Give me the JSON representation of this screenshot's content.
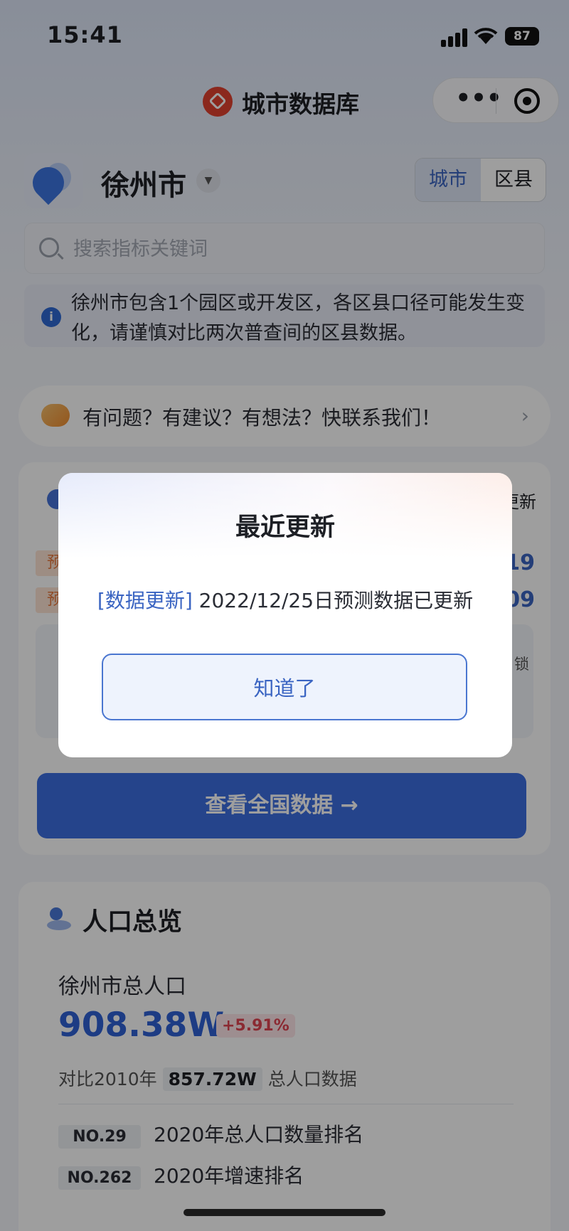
{
  "status_bar": {
    "time": "15:41",
    "battery": "87"
  },
  "nav": {
    "title": "城市数据库",
    "menu_glyph": "•••"
  },
  "city": {
    "name": "徐州市",
    "toggle": {
      "city": "城市",
      "district": "区县"
    }
  },
  "search": {
    "placeholder": "搜索指标关键词"
  },
  "notice": {
    "text": "徐州市包含1个园区或开发区，各区县口径可能发生变化，请谨慎对比两次普查间的区县数据。"
  },
  "feedback": {
    "text": "有问题？有建议？有想法？快联系我们！",
    "arrow": "›"
  },
  "card_behind": {
    "peek_right": "更新",
    "peek_tags": [
      "预",
      "预"
    ],
    "peek_nums": [
      "19",
      "09"
    ],
    "peek_lock": "锁",
    "cta": "查看全国数据 →"
  },
  "modal": {
    "title": "最近更新",
    "tag": "[数据更新]",
    "message": " 2022/12/25日预测数据已更新",
    "confirm": "知道了"
  },
  "population": {
    "heading": "人口总览",
    "label": "徐州市总人口",
    "value": "908.38W",
    "delta": "+5.91%",
    "compare_prefix": "对比2010年",
    "compare_value": "857.72W",
    "compare_suffix": "总人口数据",
    "ranks": [
      {
        "badge": "NO.29",
        "text": "2020年总人口数量排名"
      },
      {
        "badge": "NO.262",
        "text": "2020年增速排名"
      }
    ]
  }
}
